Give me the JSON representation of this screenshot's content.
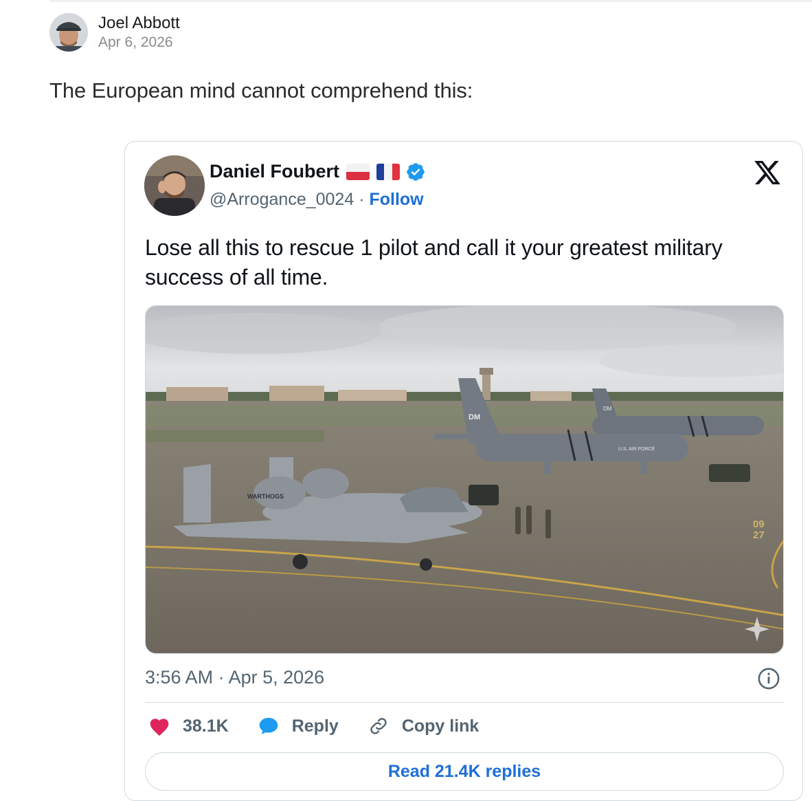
{
  "post": {
    "author": "Joel Abbott",
    "date": "Apr 6, 2026",
    "text": "The European mind cannot comprehend this:"
  },
  "embed": {
    "display_name": "Daniel Foubert",
    "flags": [
      "poland-flag",
      "france-flag"
    ],
    "verified": true,
    "handle": "@Arrogance_0024",
    "separator": " · ",
    "follow_label": "Follow",
    "text": "Lose all this to rescue 1 pilot and call it your greatest military success of all time.",
    "image": {
      "subject": "A-10 Warthog and C-130 aircraft parked on an airfield ramp",
      "markings": [
        "WARTHOGS",
        "DM",
        "U.S. AIR FORCE",
        "DM",
        "09",
        "27"
      ]
    },
    "timestamp": "3:56 AM · Apr 5, 2026",
    "actions": {
      "likes": "38.1K",
      "reply_label": "Reply",
      "copy_label": "Copy link"
    },
    "read_replies": "Read 21.4K replies"
  },
  "colors": {
    "accent_blue": "#1d6fd8",
    "like_pink": "#e0245e",
    "reply_blue": "#1d9bf0",
    "muted_text": "#536471",
    "border": "#cfd9de"
  }
}
